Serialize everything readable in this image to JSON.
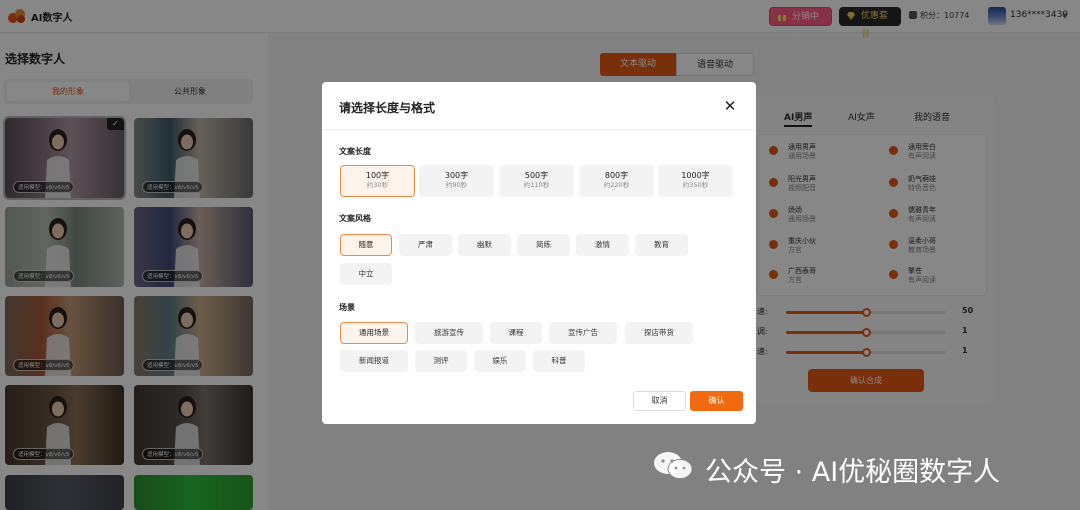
{
  "app": {
    "title": "AI数字人"
  },
  "topbar": {
    "distribution_label": "分销中心",
    "package_label": "优惠套餐",
    "points_label": "积分：10774",
    "user_id": "136****3439"
  },
  "left_panel": {
    "title": "选择数字人",
    "tabs": [
      "我的形象",
      "公共形象"
    ],
    "cards": [
      {
        "model": "适用模型：v8/v6/v5",
        "selected": true
      },
      {
        "model": "适用模型：v8/v6/v5",
        "selected": false
      },
      {
        "model": "适用模型：v8/v6/v5",
        "selected": false
      },
      {
        "model": "适用模型：v8/v6/v5",
        "selected": false
      },
      {
        "model": "适用模型：v8/v6/v5",
        "selected": false
      },
      {
        "model": "适用模型：v8/v6/v5",
        "selected": false
      },
      {
        "model": "适用模型：v8/v6/v5",
        "selected": false
      },
      {
        "model": "适用模型：v8/v6/v5",
        "selected": false
      }
    ]
  },
  "right_panel": {
    "drive_tabs": [
      "文本驱动",
      "语音驱动"
    ],
    "voice_tabs": [
      "AI男声",
      "AI女声",
      "我的语音"
    ],
    "voices": [
      {
        "name": "通用男声",
        "desc": "通用场景"
      },
      {
        "name": "通用旁白",
        "desc": "有声阅读"
      },
      {
        "name": "阳光男声",
        "desc": "视频配音"
      },
      {
        "name": "奶气萌娃",
        "desc": "特色音色"
      },
      {
        "name": "炀炀",
        "desc": "通用场景"
      },
      {
        "name": "儒雅青年",
        "desc": "有声阅读"
      },
      {
        "name": "重庆小伙",
        "desc": "方言"
      },
      {
        "name": "温柔小哥",
        "desc": "教育场景"
      },
      {
        "name": "广西表哥",
        "desc": "方言"
      },
      {
        "name": "擎苍",
        "desc": "有声阅读"
      }
    ],
    "sliders": [
      {
        "label_tail": "速:",
        "value": "50",
        "fraction": 0.5
      },
      {
        "label_tail": "调:",
        "value": "1",
        "fraction": 0.5
      },
      {
        "label_tail": "速:",
        "value": "1",
        "fraction": 0.5
      }
    ],
    "synth_button": "确认合成"
  },
  "modal": {
    "title": "请选择长度与格式",
    "length_label": "文案长度",
    "lengths": [
      {
        "main": "100字",
        "sub": "约30秒",
        "selected": true
      },
      {
        "main": "300字",
        "sub": "约90秒",
        "selected": false
      },
      {
        "main": "500字",
        "sub": "约110秒",
        "selected": false
      },
      {
        "main": "800字",
        "sub": "约220秒",
        "selected": false
      },
      {
        "main": "1000字",
        "sub": "约350秒",
        "selected": false
      }
    ],
    "style_label": "文案风格",
    "styles": [
      {
        "label": "随意",
        "selected": true
      },
      {
        "label": "严肃",
        "selected": false
      },
      {
        "label": "幽默",
        "selected": false
      },
      {
        "label": "简练",
        "selected": false
      },
      {
        "label": "激情",
        "selected": false
      },
      {
        "label": "教育",
        "selected": false
      },
      {
        "label": "中立",
        "selected": false
      }
    ],
    "scene_label": "场景",
    "scenes": [
      {
        "label": "通用场景",
        "selected": true
      },
      {
        "label": "旅游宣传",
        "selected": false
      },
      {
        "label": "课程",
        "selected": false
      },
      {
        "label": "宣传广告",
        "selected": false
      },
      {
        "label": "探店带货",
        "selected": false
      },
      {
        "label": "新闻报道",
        "selected": false
      },
      {
        "label": "测评",
        "selected": false
      },
      {
        "label": "娱乐",
        "selected": false
      },
      {
        "label": "科普",
        "selected": false
      }
    ],
    "cancel_label": "取消",
    "confirm_label": "确认"
  },
  "watermark": {
    "text": "公众号 · AI优秘圈数字人"
  },
  "colors": {
    "accent": "#e25a13",
    "accent_light": "#fff4ec",
    "overlay": "rgba(0,0,0,0.47)"
  }
}
